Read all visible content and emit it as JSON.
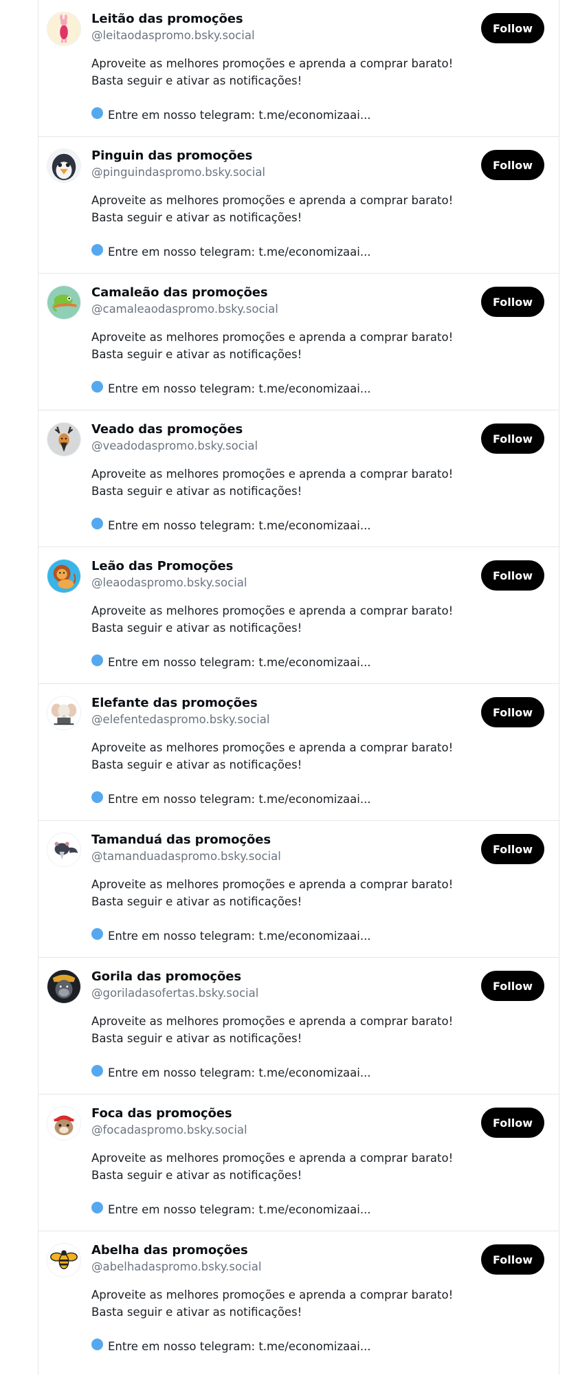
{
  "common": {
    "follow_label": "Follow",
    "description_line1": "Aproveite as melhores promoções e aprenda a comprar barato!",
    "description_line2": "Basta seguir e ativar as notificações!",
    "telegram_text": "Entre em nosso telegram: t.me/economizaai...",
    "telegram_icon": "blue-circle-icon"
  },
  "colors": {
    "follow_bg": "#000000",
    "follow_text": "#ffffff",
    "handle": "#6a7480",
    "blue_dot": "#55a8ee",
    "divider": "#e3e6ea"
  },
  "profiles": [
    {
      "name": "Leitão das promoções",
      "handle": "@leitaodaspromo.bsky.social",
      "avatar": "piglet-avatar"
    },
    {
      "name": "Pinguin das promoções",
      "handle": "@pinguindaspromo.bsky.social",
      "avatar": "penguin-avatar"
    },
    {
      "name": "Camaleão das promoções",
      "handle": "@camaleaodaspromo.bsky.social",
      "avatar": "chameleon-avatar"
    },
    {
      "name": "Veado das promoções",
      "handle": "@veadodaspromo.bsky.social",
      "avatar": "deer-avatar"
    },
    {
      "name": "Leão das Promoções",
      "handle": "@leaodaspromo.bsky.social",
      "avatar": "lion-avatar"
    },
    {
      "name": "Elefante das promoções",
      "handle": "@elefentedaspromo.bsky.social",
      "avatar": "elephant-avatar"
    },
    {
      "name": "Tamanduá das promoções",
      "handle": "@tamanduadaspromo.bsky.social",
      "avatar": "anteater-avatar"
    },
    {
      "name": "Gorila das promoções",
      "handle": "@goriladasofertas.bsky.social",
      "avatar": "gorilla-avatar"
    },
    {
      "name": "Foca das promoções",
      "handle": "@focadaspromo.bsky.social",
      "avatar": "seal-avatar"
    },
    {
      "name": "Abelha das promoções",
      "handle": "@abelhadaspromo.bsky.social",
      "avatar": "bee-avatar"
    }
  ]
}
